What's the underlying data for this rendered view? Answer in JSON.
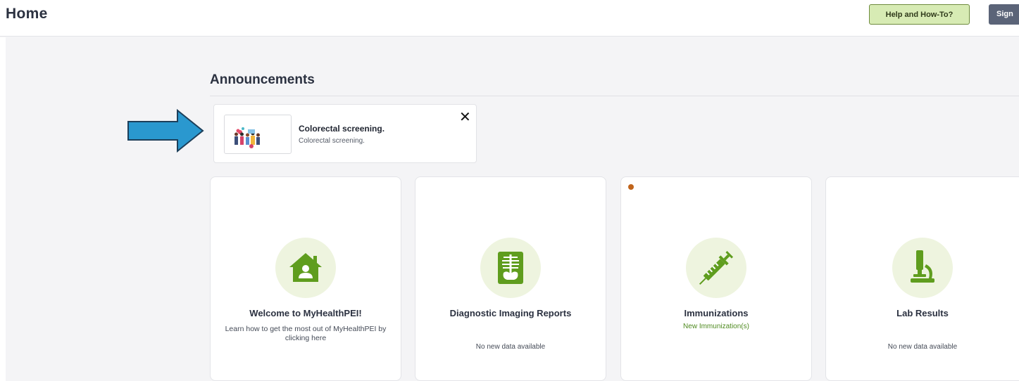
{
  "header": {
    "title": "Home",
    "help_label": "Help and How-To?",
    "sign_label": "Sign"
  },
  "announcements": {
    "heading": "Announcements",
    "items": [
      {
        "title": "Colorectal screening.",
        "subtitle": "Colorectal screening.",
        "close_glyph": "✕"
      }
    ]
  },
  "tiles": [
    {
      "icon": "home-person-icon",
      "title": "Welcome to MyHealthPEI!",
      "desc": "Learn how to get the most out of MyHealthPEI by clicking here"
    },
    {
      "icon": "xray-icon",
      "title": "Diagnostic Imaging Reports",
      "status": "No new data available"
    },
    {
      "icon": "syringe-icon",
      "title": "Immunizations",
      "status": "New Immunization(s)",
      "has_new_indicator": true
    },
    {
      "icon": "microscope-icon",
      "title": "Lab Results",
      "status": "No new data available"
    }
  ],
  "colors": {
    "icon_green": "#5f9d1e",
    "icon_bg": "#eef4df",
    "help_bg": "#d7ebb4",
    "sign_bg": "#5b6478",
    "arrow": "#2a98cf",
    "new_dot": "#c0641b",
    "new_text": "#4e8a1f"
  }
}
